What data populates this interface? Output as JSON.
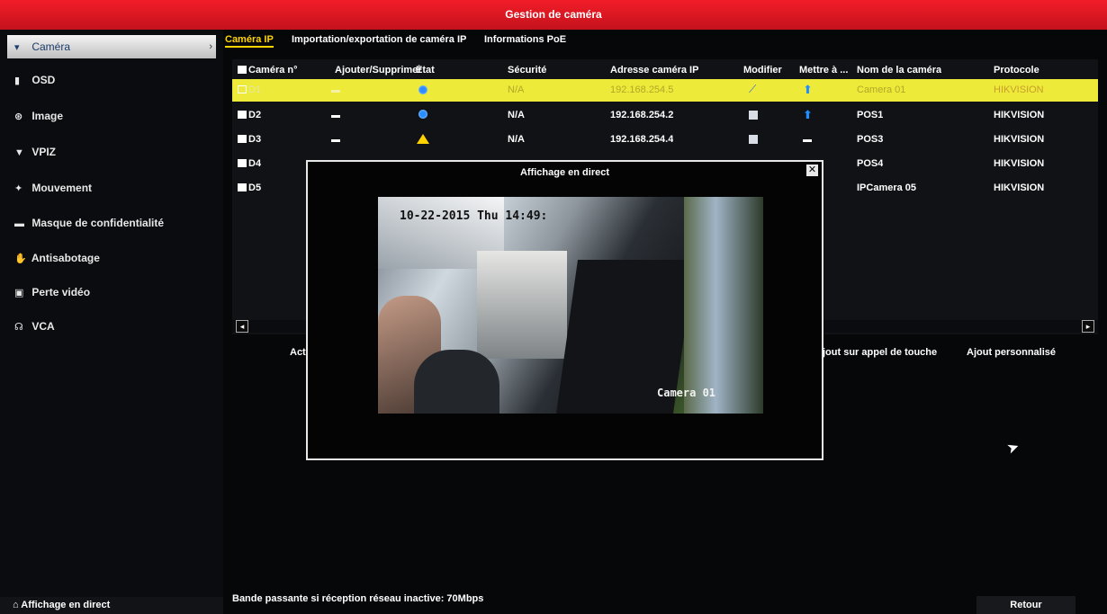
{
  "window": {
    "title": "Gestion de caméra"
  },
  "sidebar": {
    "items": [
      {
        "label": "Caméra",
        "icon": "camera-icon",
        "glyph": "▾",
        "active": true
      },
      {
        "label": "OSD",
        "icon": "osd-icon",
        "glyph": "▮"
      },
      {
        "label": "Image",
        "icon": "image-icon",
        "glyph": "⊛"
      },
      {
        "label": "VPIZ",
        "icon": "ptz-icon",
        "glyph": "▼"
      },
      {
        "label": "Mouvement",
        "icon": "motion-icon",
        "glyph": "✦"
      },
      {
        "label": "Masque de confidentialité",
        "icon": "privacy-mask-icon",
        "glyph": "▬"
      },
      {
        "label": "Antisabotage",
        "icon": "tamper-icon",
        "glyph": "✋"
      },
      {
        "label": "Perte vidéo",
        "icon": "video-loss-icon",
        "glyph": "▣"
      },
      {
        "label": "VCA",
        "icon": "vca-icon",
        "glyph": "☊"
      }
    ],
    "live_view": "Affichage en direct"
  },
  "tabs": [
    "Caméra IP",
    "Importation/exportation de caméra IP",
    "Informations PoE"
  ],
  "table": {
    "headers": [
      "Caméra n°",
      "Ajouter/Supprimer",
      "État",
      "Sécurité",
      "Adresse caméra IP",
      "Modifier",
      "Mettre à ...",
      "Nom de la caméra",
      "Protocole"
    ],
    "rows": [
      {
        "id": "D1",
        "state": "dot",
        "security": "N/A",
        "ip": "192.168.254.5",
        "edit": "pen",
        "update": "up",
        "name": "Camera 01",
        "protocol": "HIKVISION",
        "selected": true
      },
      {
        "id": "D2",
        "state": "dot",
        "security": "N/A",
        "ip": "192.168.254.2",
        "edit": "box",
        "update": "up",
        "name": "POS1",
        "protocol": "HIKVISION"
      },
      {
        "id": "D3",
        "state": "warn",
        "security": "N/A",
        "ip": "192.168.254.4",
        "edit": "box",
        "update": "dash",
        "name": "POS3",
        "protocol": "HIKVISION"
      },
      {
        "id": "D4",
        "name": "POS4",
        "protocol": "HIKVISION"
      },
      {
        "id": "D5",
        "name": "IPCamera 05",
        "protocol": "HIKVISION"
      }
    ]
  },
  "actions": {
    "left_partial": "Act",
    "one_touch": "jout sur appel de touche",
    "custom": "Ajout personnalisé"
  },
  "popup": {
    "title": "Affichage en direct",
    "osd_time": "10-22-2015 Thu 14:49:",
    "osd_name": "Camera 01"
  },
  "footer": {
    "bandwidth": "Bande passante si réception réseau inactive: 70Mbps",
    "back": "Retour"
  }
}
